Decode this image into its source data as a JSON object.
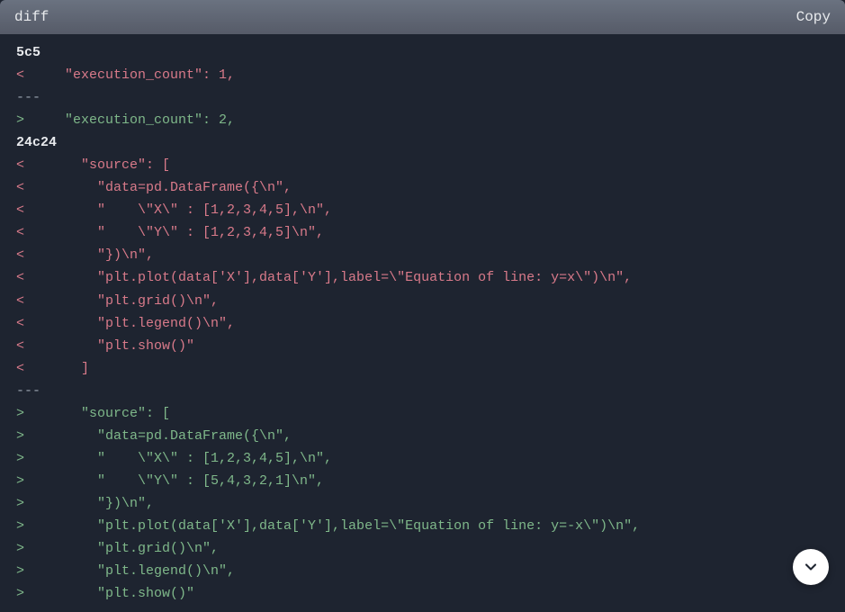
{
  "header": {
    "language_label": "diff",
    "copy_label": "Copy"
  },
  "code": {
    "lines": [
      {
        "type": "hunk",
        "text": "5c5"
      },
      {
        "type": "del",
        "text": "<     \"execution_count\": 1,"
      },
      {
        "type": "sep",
        "text": "---"
      },
      {
        "type": "add",
        "text": ">     \"execution_count\": 2,"
      },
      {
        "type": "hunk",
        "text": "24c24"
      },
      {
        "type": "del",
        "text": "<       \"source\": ["
      },
      {
        "type": "del",
        "text": "<         \"data=pd.DataFrame({\\n\","
      },
      {
        "type": "del",
        "text": "<         \"    \\\"X\\\" : [1,2,3,4,5],\\n\","
      },
      {
        "type": "del",
        "text": "<         \"    \\\"Y\\\" : [1,2,3,4,5]\\n\","
      },
      {
        "type": "del",
        "text": "<         \"})\\n\","
      },
      {
        "type": "del",
        "text": "<         \"plt.plot(data['X'],data['Y'],label=\\\"Equation of line: y=x\\\")\\n\","
      },
      {
        "type": "del",
        "text": "<         \"plt.grid()\\n\","
      },
      {
        "type": "del",
        "text": "<         \"plt.legend()\\n\","
      },
      {
        "type": "del",
        "text": "<         \"plt.show()\""
      },
      {
        "type": "del",
        "text": "<       ]"
      },
      {
        "type": "sep",
        "text": "---"
      },
      {
        "type": "add",
        "text": ">       \"source\": ["
      },
      {
        "type": "add",
        "text": ">         \"data=pd.DataFrame({\\n\","
      },
      {
        "type": "add",
        "text": ">         \"    \\\"X\\\" : [1,2,3,4,5],\\n\","
      },
      {
        "type": "add",
        "text": ">         \"    \\\"Y\\\" : [5,4,3,2,1]\\n\","
      },
      {
        "type": "add",
        "text": ">         \"})\\n\","
      },
      {
        "type": "add",
        "text": ">         \"plt.plot(data['X'],data['Y'],label=\\\"Equation of line: y=-x\\\")\\n\","
      },
      {
        "type": "add",
        "text": ">         \"plt.grid()\\n\","
      },
      {
        "type": "add",
        "text": ">         \"plt.legend()\\n\","
      },
      {
        "type": "add",
        "text": ">         \"plt.show()\""
      }
    ]
  }
}
